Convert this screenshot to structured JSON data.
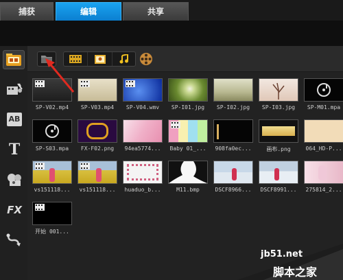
{
  "tabs": [
    {
      "label": "捕获",
      "active": false
    },
    {
      "label": "编辑",
      "active": true
    },
    {
      "label": "共享",
      "active": false
    }
  ],
  "sidebar": {
    "items": [
      {
        "name": "media-library-icon",
        "selected": true
      },
      {
        "name": "instant-project-icon"
      },
      {
        "name": "transition-icon",
        "text": "AB"
      },
      {
        "name": "title-icon",
        "text": "T"
      },
      {
        "name": "graphics-icon"
      },
      {
        "name": "filter-icon",
        "text": "FX"
      },
      {
        "name": "path-icon"
      }
    ]
  },
  "toolbar": {
    "items": [
      "folder-icon",
      "video-filter-icon",
      "photo-filter-icon",
      "audio-filter-icon",
      "reel-icon"
    ]
  },
  "media": [
    {
      "label": "SP-V02.mp4",
      "kind": "video"
    },
    {
      "label": "SP-V03.mp4",
      "kind": "video"
    },
    {
      "label": "SP-V04.wmv",
      "kind": "video"
    },
    {
      "label": "SP-I01.jpg",
      "kind": "image"
    },
    {
      "label": "SP-I02.jpg",
      "kind": "image"
    },
    {
      "label": "SP-I03.jpg",
      "kind": "image"
    },
    {
      "label": "SP-M01.mpa",
      "kind": "audio"
    },
    {
      "label": "SP-S03.mpa",
      "kind": "audio"
    },
    {
      "label": "FX-F02.png",
      "kind": "image"
    },
    {
      "label": "94ea5774...",
      "kind": "image"
    },
    {
      "label": "Baby 01_...",
      "kind": "video"
    },
    {
      "label": "908fa0ec...",
      "kind": "image"
    },
    {
      "label": "画布.png",
      "kind": "image"
    },
    {
      "label": "064_HD-P...",
      "kind": "image"
    },
    {
      "label": "vs151118...",
      "kind": "video"
    },
    {
      "label": "vs151118...",
      "kind": "video"
    },
    {
      "label": "huaduo_b...",
      "kind": "image"
    },
    {
      "label": "M11.bmp",
      "kind": "image"
    },
    {
      "label": "DSCF8966...",
      "kind": "image"
    },
    {
      "label": "DSCF8991...",
      "kind": "image"
    },
    {
      "label": "275814_2...",
      "kind": "image"
    },
    {
      "label": "开始 001...",
      "kind": "video"
    }
  ],
  "watermark": {
    "url": "jb51.net",
    "name": "脚本之家"
  },
  "colors": {
    "active_tab": "#0b8ee0",
    "annotation_arrow": "#e02a20"
  }
}
